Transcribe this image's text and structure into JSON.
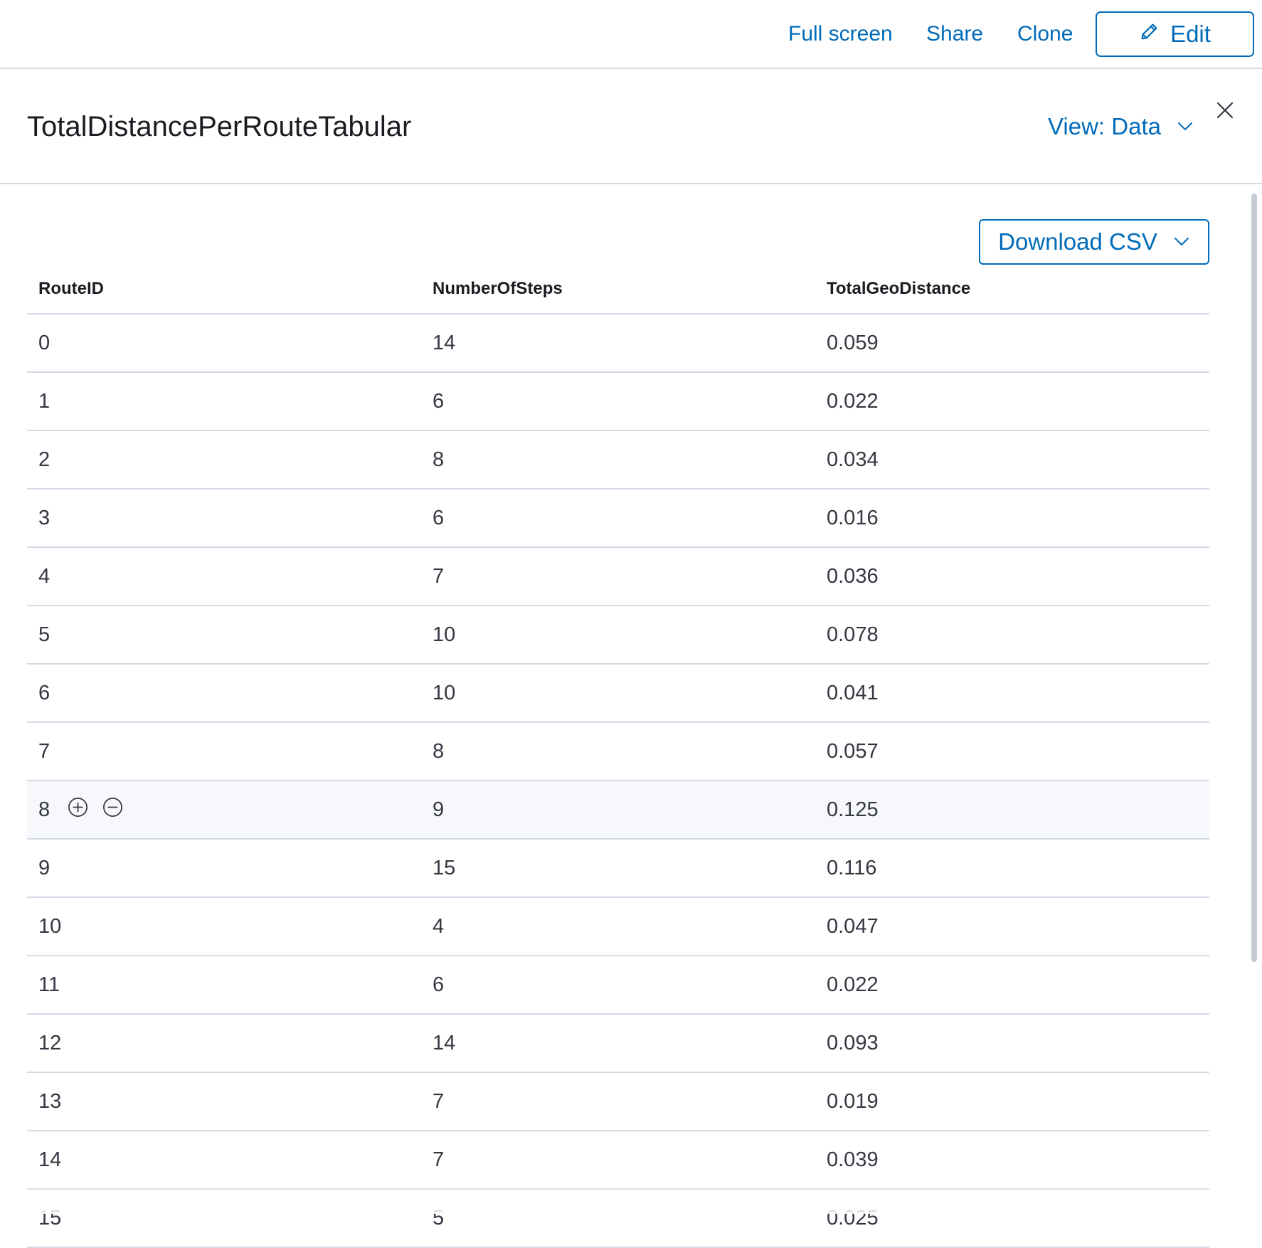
{
  "toolbar": {
    "full_screen": "Full screen",
    "share": "Share",
    "clone": "Clone",
    "edit": "Edit",
    "edit_icon": "pencil-icon"
  },
  "panel": {
    "title": "TotalDistancePerRouteTabular",
    "view_select": "View: Data",
    "view_icon": "chevron-down-icon",
    "close_icon": "close-icon"
  },
  "download": {
    "label": "Download CSV",
    "icon": "chevron-down-icon"
  },
  "table": {
    "columns": [
      "RouteID",
      "NumberOfSteps",
      "TotalGeoDistance"
    ],
    "rows": [
      [
        "0",
        "14",
        "0.059"
      ],
      [
        "1",
        "6",
        "0.022"
      ],
      [
        "2",
        "8",
        "0.034"
      ],
      [
        "3",
        "6",
        "0.016"
      ],
      [
        "4",
        "7",
        "0.036"
      ],
      [
        "5",
        "10",
        "0.078"
      ],
      [
        "6",
        "10",
        "0.041"
      ],
      [
        "7",
        "8",
        "0.057"
      ],
      [
        "8",
        "9",
        "0.125"
      ],
      [
        "9",
        "15",
        "0.116"
      ],
      [
        "10",
        "4",
        "0.047"
      ],
      [
        "11",
        "6",
        "0.022"
      ],
      [
        "12",
        "14",
        "0.093"
      ],
      [
        "13",
        "7",
        "0.019"
      ],
      [
        "14",
        "7",
        "0.039"
      ],
      [
        "15",
        "5",
        "0.025"
      ]
    ],
    "hovered_row_index": 8,
    "filter_icons": [
      "plus-circle-icon",
      "minus-circle-icon"
    ]
  },
  "colors": {
    "accent": "#006bb8",
    "border": "#d3dae6",
    "text": "#343741",
    "heading": "#1a1c21",
    "hover_row": "#f7f8fc"
  }
}
